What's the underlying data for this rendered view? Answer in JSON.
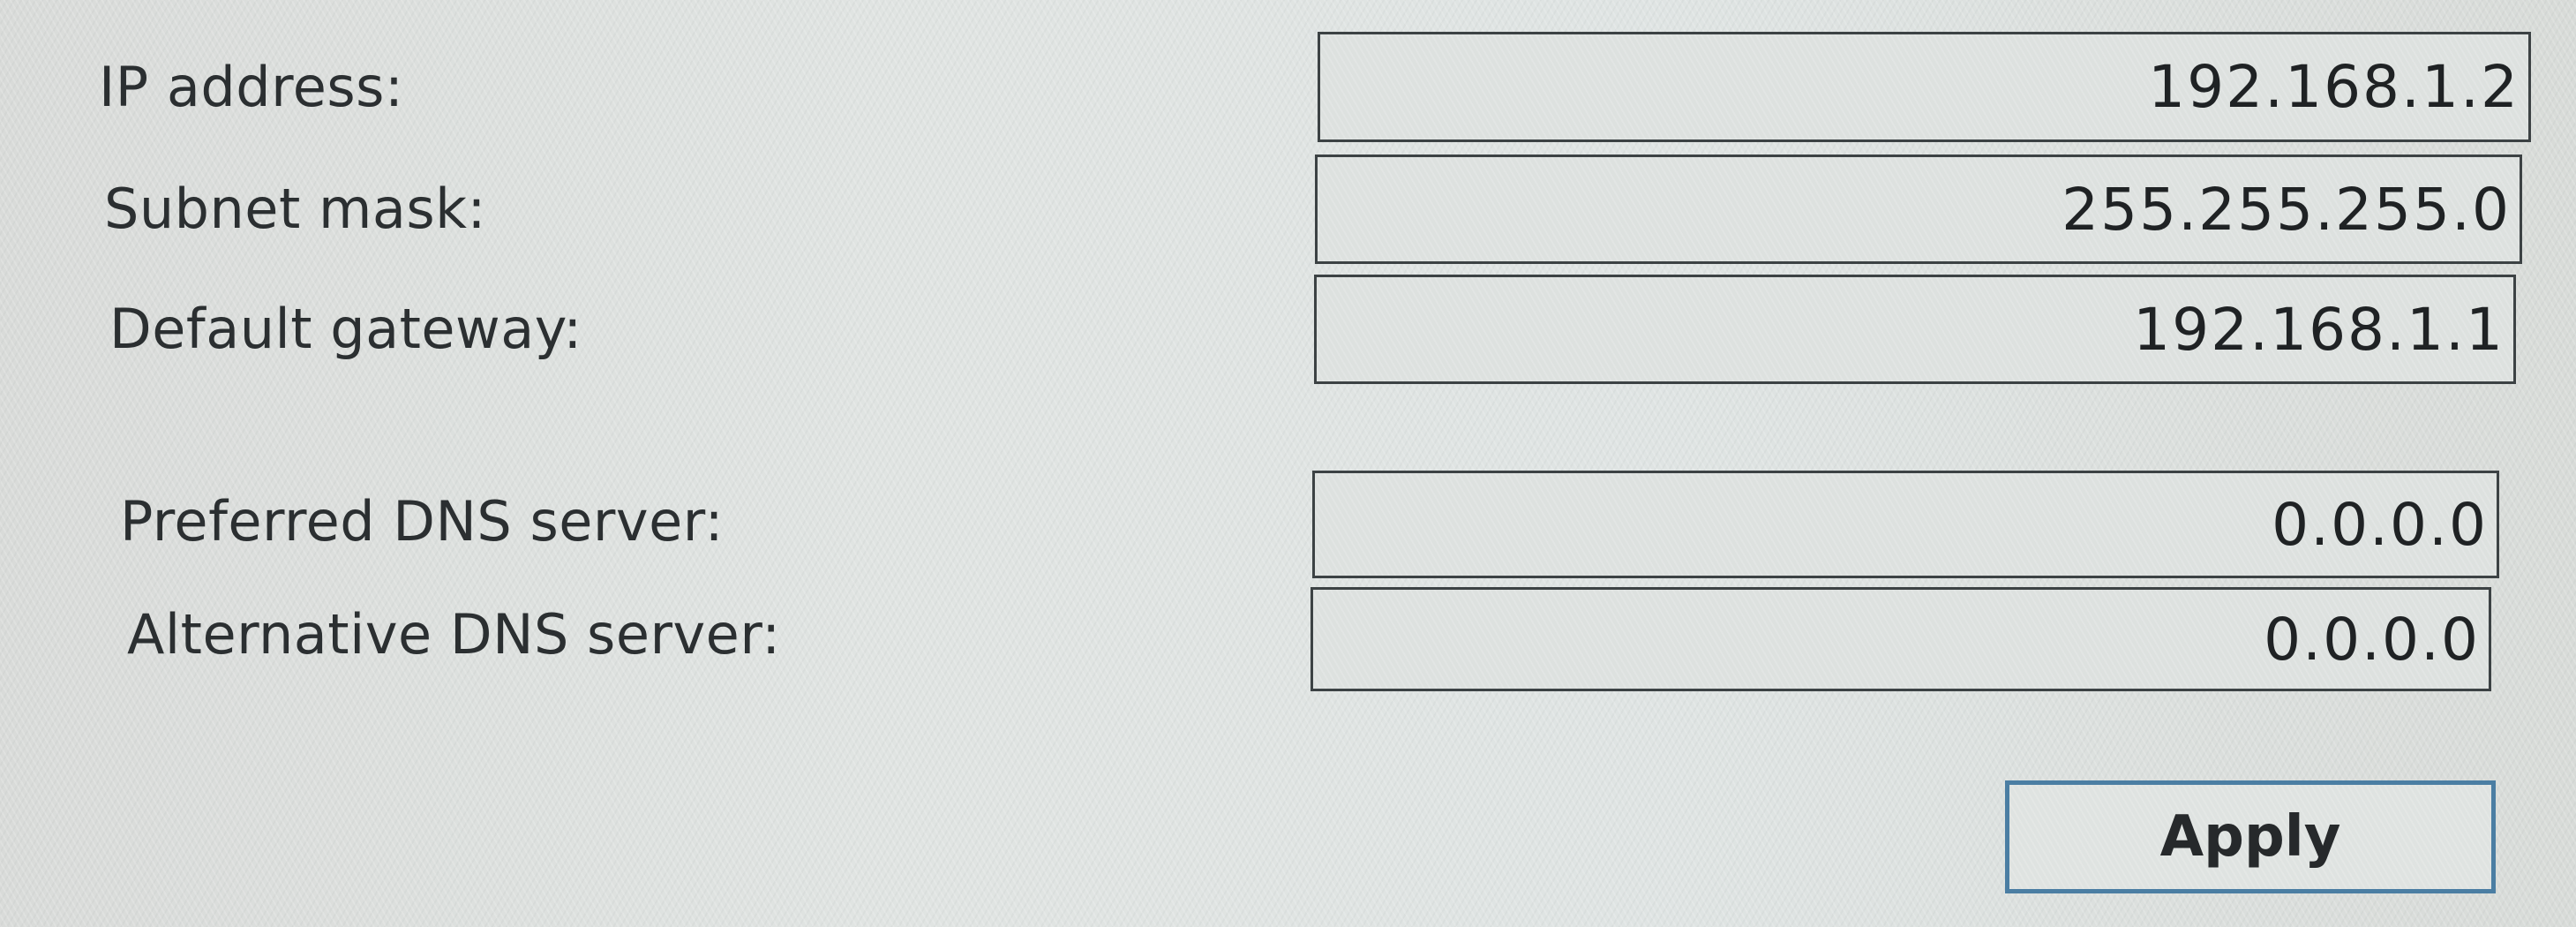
{
  "ip_settings": {
    "ip_address": {
      "label": "IP address:",
      "value": "192.168.1.2"
    },
    "subnet_mask": {
      "label": "Subnet mask:",
      "value": "255.255.255.0"
    },
    "default_gateway": {
      "label": "Default gateway:",
      "value": "192.168.1.1"
    }
  },
  "dns_settings": {
    "preferred_dns": {
      "label": "Preferred DNS server:",
      "value": "0.0.0.0"
    },
    "alternative_dns": {
      "label": "Alternative DNS server:",
      "value": "0.0.0.0"
    }
  },
  "actions": {
    "apply_label": "Apply"
  },
  "colors": {
    "button_border": "#4b7ea3",
    "field_border": "#3c4244",
    "background": "#dfe4e3"
  }
}
